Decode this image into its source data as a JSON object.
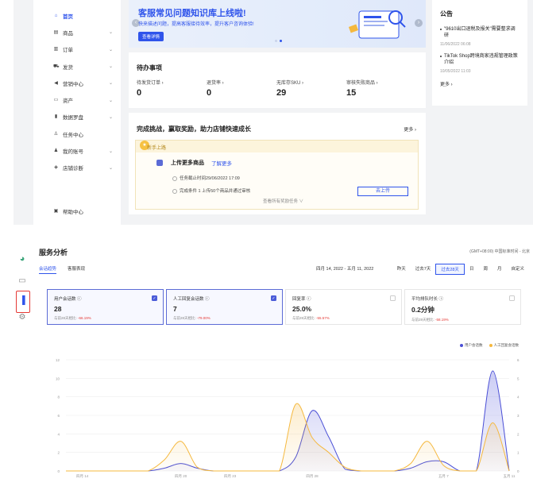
{
  "sidebar": {
    "items": [
      {
        "label": "首页",
        "icon": "home-icon",
        "glyph": "⌂",
        "chev": false,
        "active": true
      },
      {
        "label": "商品",
        "icon": "product-icon",
        "glyph": "▤",
        "chev": true
      },
      {
        "label": "订单",
        "icon": "order-icon",
        "glyph": "▥",
        "chev": true
      },
      {
        "label": "发货",
        "icon": "truck-icon",
        "glyph": "⛟",
        "chev": true
      },
      {
        "label": "营销中心",
        "icon": "megaphone-icon",
        "glyph": "◀",
        "chev": true
      },
      {
        "label": "资产",
        "icon": "wallet-icon",
        "glyph": "▭",
        "chev": true
      },
      {
        "label": "数据罗盘",
        "icon": "bar-chart-icon",
        "glyph": "▮",
        "chev": true
      },
      {
        "label": "任务中心",
        "icon": "task-icon",
        "glyph": "♙",
        "chev": false
      },
      {
        "label": "我的账号",
        "icon": "user-icon",
        "glyph": "♟",
        "chev": true
      },
      {
        "label": "店铺诊断",
        "icon": "shield-icon",
        "glyph": "◈",
        "chev": true
      }
    ],
    "help": {
      "label": "帮助中心",
      "icon": "help-icon",
      "glyph": "▣"
    }
  },
  "banner": {
    "title": "客服常见问题知识库上线啦!",
    "subtitle": "快来描述问题，提高客服接待效率，提升客户咨询体验!",
    "button": "查看详情"
  },
  "announcement": {
    "heading": "公告",
    "items": [
      {
        "title": "\"9610出口退税及报关\"需要整求调研",
        "date": "11/06/2022 06:08"
      },
      {
        "title": "TikTok Shop跨境商家违规管理政策介绍",
        "date": "10/05/2022 11:03"
      }
    ],
    "more": "更多 ›"
  },
  "todo": {
    "heading": "待办事项",
    "items": [
      {
        "label": "待发货订单 ›",
        "value": "0"
      },
      {
        "label": "退货率 ›",
        "value": "0"
      },
      {
        "label": "无库存SKU ›",
        "value": "29"
      },
      {
        "label": "审核失败商品 ›",
        "value": "15"
      }
    ]
  },
  "challenge": {
    "heading": "完成挑战，赢取奖励，助力店铺快速成长",
    "more": "更多 ›",
    "band": "新手上路",
    "task_title": "上传更多商品",
    "task_link": "了解更多",
    "deadline": "任务截止时间29/06/2022 17:09",
    "condition": "完成条件 1  上传50个商品并通过审核",
    "button": "去上传",
    "see_more": "查看所有奖励任务 ∨"
  },
  "service": {
    "title": "服务分析",
    "timezone": "(GMT+08:00) 中国标准时间 - 北京",
    "tabs": [
      "会话趋势",
      "客服表现"
    ],
    "range": "四月 14, 2022 - 五月 11, 2022",
    "segments": [
      "昨天",
      "过去7天",
      "过去28天",
      "日",
      "周",
      "月",
      "自定义"
    ],
    "metrics": [
      {
        "label": "用户会话数 ⓘ",
        "value": "28",
        "compare": "与前28天相比:",
        "change": "-66.19%",
        "checked": true
      },
      {
        "label": "人工回复会话数 ⓘ",
        "value": "7",
        "compare": "与前28天相比:",
        "change": "-79.00%",
        "checked": true
      },
      {
        "label": "回复率 ⓘ",
        "value": "25.0%",
        "compare": "与前28天相比:",
        "change": "-55.57%",
        "checked": false
      },
      {
        "label": "平均排队时长 ⓘ",
        "value": "0.2分钟",
        "compare": "与前28天相比:",
        "change": "-58.19%",
        "checked": false
      }
    ],
    "legend": [
      "用户会话数",
      "人工回复会话数"
    ]
  },
  "colors": {
    "primary": "#2f54eb",
    "series1": "#4a4fd6",
    "series2": "#f5b83d",
    "decline": "#e53935"
  },
  "chart_data": {
    "type": "area",
    "x": [
      0,
      1,
      2,
      3,
      4,
      5,
      6,
      7,
      8,
      9,
      10,
      11,
      12,
      13,
      14,
      15,
      16,
      17,
      18,
      19,
      20,
      21,
      22,
      23,
      24,
      25,
      26,
      27
    ],
    "x_ticks": [
      {
        "i": 1,
        "label": "四月 14"
      },
      {
        "i": 7,
        "label": "四月 20"
      },
      {
        "i": 10,
        "label": "四月 23"
      },
      {
        "i": 15,
        "label": "四月 28"
      },
      {
        "i": 23,
        "label": "五月 7"
      },
      {
        "i": 27,
        "label": "五月 11"
      }
    ],
    "series": [
      {
        "name": "用户会话数",
        "axis": "left",
        "values": [
          0,
          0,
          0,
          0,
          0,
          0,
          0.3,
          0.8,
          0.3,
          0,
          0,
          0,
          0,
          0,
          1.5,
          6.5,
          3.7,
          0.2,
          0,
          0,
          0,
          0.3,
          1,
          1,
          0,
          0,
          10.8,
          0
        ]
      },
      {
        "name": "人工回复会话数",
        "axis": "right",
        "values": [
          0,
          0,
          0,
          0,
          0,
          0,
          0.6,
          1.6,
          0.2,
          0,
          0,
          0,
          0,
          0,
          3.6,
          1.8,
          1,
          0.2,
          0,
          0,
          0,
          0.4,
          1.6,
          0.3,
          0,
          0,
          2.6,
          0
        ]
      }
    ],
    "ylim_left": [
      0,
      12
    ],
    "yticks_left": [
      0,
      2,
      4,
      6,
      8,
      10,
      12
    ],
    "ylim_right": [
      0,
      6
    ],
    "yticks_right": [
      0,
      1,
      2,
      3,
      4,
      5,
      6
    ]
  }
}
